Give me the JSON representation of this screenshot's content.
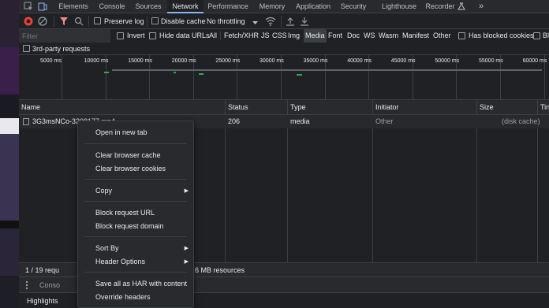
{
  "tabs": [
    {
      "label": "Elements",
      "active": false
    },
    {
      "label": "Console",
      "active": false
    },
    {
      "label": "Sources",
      "active": false
    },
    {
      "label": "Network",
      "active": true
    },
    {
      "label": "Performance",
      "active": false
    },
    {
      "label": "Memory",
      "active": false
    },
    {
      "label": "Application",
      "active": false
    },
    {
      "label": "Security",
      "active": false
    },
    {
      "label": "Lighthouse",
      "active": false
    },
    {
      "label": "Recorder",
      "active": false
    }
  ],
  "tabs_more": "»",
  "toolbar": {
    "preserve_log": "Preserve log",
    "disable_cache": "Disable cache",
    "throttling": "No throttling"
  },
  "filter": {
    "placeholder": "Filter",
    "invert": "Invert",
    "hide_data_urls": "Hide data URLs",
    "types": [
      "All",
      "Fetch/XHR",
      "JS",
      "CSS",
      "Img",
      "Media",
      "Font",
      "Doc",
      "WS",
      "Wasm",
      "Manifest",
      "Other"
    ],
    "active_type": "Media",
    "has_blocked_cookies": "Has blocked cookies",
    "blocked_truncated": "Bl",
    "third_party": "3rd-party requests"
  },
  "timeline": {
    "ticks": [
      "5000 ms",
      "10000 ms",
      "15000 ms",
      "20000 ms",
      "25000 ms",
      "30000 ms",
      "35000 ms",
      "40000 ms",
      "45000 ms",
      "50000 ms",
      "55000 ms",
      "60000 ms"
    ]
  },
  "columns": {
    "name": "Name",
    "status": "Status",
    "type": "Type",
    "initiator": "Initiator",
    "size": "Size",
    "time": "Tin"
  },
  "row": {
    "name": "3G3msNCo-3208177.mp4",
    "status": "206",
    "type": "media",
    "initiator": "Other",
    "size": "(disk cache)"
  },
  "statusbar": {
    "requests": "1 / 19 requ",
    "resources": "8 / 12.6 MB resources"
  },
  "drawer": {
    "console_tab": "Conso",
    "highlights": "Highlights"
  },
  "context_menu": {
    "items": [
      "Open in new tab",
      "Clear browser cache",
      "Clear browser cookies",
      "Copy",
      "Block request URL",
      "Block request domain",
      "Sort By",
      "Header Options",
      "Save all as HAR with content",
      "Override headers"
    ]
  },
  "colors": {
    "record": "#ea4335",
    "filter_icon": "#f28b82",
    "accent": "#8ab4f8",
    "bar_green": "#34a853",
    "bar_red": "#ea4335"
  }
}
